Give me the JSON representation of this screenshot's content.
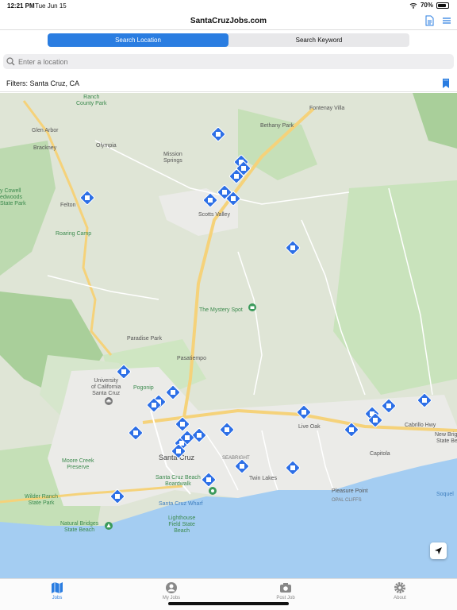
{
  "status_bar": {
    "time": "12:21 PM",
    "date": "Tue Jun 15",
    "battery": "70%"
  },
  "nav": {
    "title": "SantaCruzJobs.com"
  },
  "segments": {
    "active": "Search Location",
    "inactive": "Search Keyword"
  },
  "search": {
    "placeholder": "Enter a location"
  },
  "filters": {
    "label": "Filters: Santa Cruz, CA"
  },
  "map": {
    "labels": {
      "ranch_county_park": "Ranch\nCounty Park",
      "fontenay_villa": "Fontenay Villa",
      "glen_arbor": "Glen Arbor",
      "bethany_park": "Bethany Park",
      "brackney": "Brackney",
      "olympia": "Olympia",
      "mission_springs": "Mission\nSprings",
      "cowell": "y Cowell\nedwoods\nState Park",
      "felton": "Felton",
      "scotts_valley": "Scotts Valley",
      "roaring_camp": "Roaring Camp",
      "mystery_spot": "The Mystery Spot",
      "paradise_park": "Paradise Park",
      "pasatiempo": "Pasatiempo",
      "ucsc": "University\nof California\nSanta Cruz",
      "pogonip": "Pogonip",
      "moore_creek": "Moore Creek\nPreserve",
      "santa_cruz": "Santa Cruz",
      "seabright": "SEABRIGHT",
      "live_oak": "Live Oak",
      "capitola": "Capitola",
      "new_brighton": "New Brighton\nState Beach",
      "cabrillo_hwy": "Cabrillo Hwy",
      "twin_lakes": "Twin Lakes",
      "boardwalk": "Santa Cruz Beach\nBoardwalk",
      "wharf": "Santa Cruz Wharf",
      "wilder_ranch": "Wilder Ranch\nState Park",
      "pleasure_point": "Pleasure Point",
      "opal_cliffs": "OPAL CLIFFS",
      "soquel": "Soquel",
      "natural_bridges": "Natural Bridges\nState Beach",
      "lighthouse": "Lighthouse\nField State\nBeach"
    },
    "job_pin_count": 30
  },
  "tabs": [
    {
      "label": "Jobs",
      "icon": "map-icon"
    },
    {
      "label": "My Jobs",
      "icon": "person-icon"
    },
    {
      "label": "Post Job",
      "icon": "camera-icon"
    },
    {
      "label": "About",
      "icon": "gear-icon"
    }
  ],
  "colors": {
    "accent": "#2a7de1",
    "pin": "#2d6fe6",
    "water": "#a4cdf2",
    "park": "#c3e2b4"
  }
}
